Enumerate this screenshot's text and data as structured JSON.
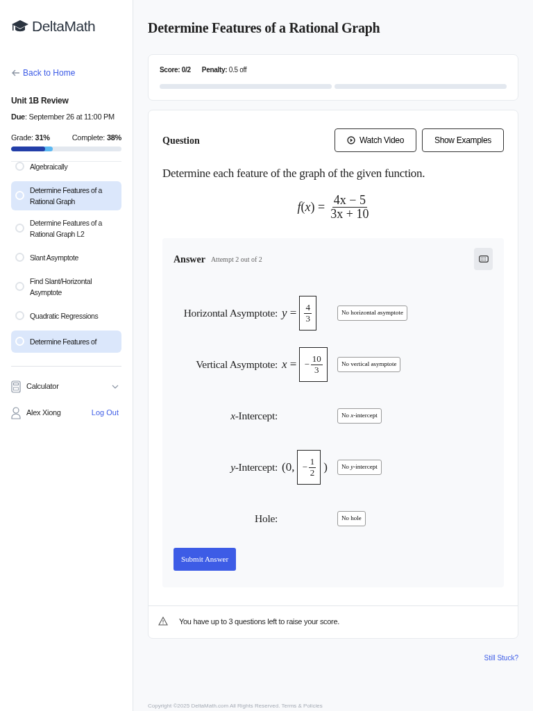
{
  "sidebar": {
    "logo": "DeltaMath",
    "back_link": "Back to Home",
    "assignment": {
      "title": "Unit 1B Review",
      "due": "**Due**: September 26 at 11:00 PM",
      "grade": "Grade: **31%**",
      "complete": "Complete: **38%**"
    },
    "progress": [
      {
        "kind": "grade",
        "level": 0.31
      },
      {
        "kind": "complete",
        "level": 0.38
      }
    ],
    "items": [
      {
        "label": "Algebraically",
        "selected": false
      },
      {
        "label": "Determine Features of a Rational Graph",
        "selected": true
      },
      {
        "label": "Determine Features of a Rational Graph L2",
        "selected": false
      },
      {
        "label": "Slant Asymptote",
        "selected": false
      },
      {
        "label": "Find Slant/Horizontal Asymptote",
        "selected": false
      },
      {
        "label": "Quadratic Regressions",
        "selected": false
      },
      {
        "label": "Determine Features of",
        "selected": true
      }
    ],
    "calculator": "Calculator",
    "user": {
      "name": "Alex Xiong",
      "logout": "Log Out"
    }
  },
  "main": {
    "title": "Determine Features of a Rational Graph",
    "score": {
      "score": "Score: 0/2",
      "penalty": "**Penalty:** 0.5 off",
      "segments": [
        {
          "level": 0
        },
        {
          "level": 0
        }
      ]
    },
    "question": {
      "heading": "Question",
      "buttons": [
        {
          "label": "Watch Video",
          "kind": "video"
        },
        {
          "label": "Show Examples",
          "kind": "plain"
        }
      ],
      "prompt": "Determine each feature of the graph of the given function.",
      "function": {
        "lhs": "*f*(*x*) =",
        "numerator": "4x − 5",
        "denominator": "3x + 10"
      }
    },
    "answer": {
      "heading": "Answer",
      "attempt": "Attempt 2 out of 2",
      "rows": [
        {
          "kind": "equation",
          "label": "Horizontal Asymptote:",
          "lhs": "*y* =",
          "sign": "",
          "numerator": "4",
          "denominator": "3",
          "button": "No horizontal asymptote"
        },
        {
          "kind": "equation",
          "label": "Vertical Asymptote:",
          "lhs": "*x* =",
          "sign": "−",
          "numerator": "10",
          "denominator": "3",
          "button": "No vertical asymptote"
        },
        {
          "kind": "none",
          "label": "*x*-Intercept:",
          "button": "No *x*-intercept"
        },
        {
          "kind": "point",
          "label": "*y*-Intercept:",
          "prefix": "(0,",
          "sign": "−",
          "numerator": "1",
          "denominator": "2",
          "suffix": ")",
          "button": "No *y*-intercept"
        },
        {
          "kind": "none",
          "label": "Hole:",
          "button": "No hole"
        }
      ],
      "submit": "Submit Answer"
    },
    "notice": "You have up to 3 questions left to raise your score.",
    "still_stuck": "Still Stuck?",
    "copyright": "Copyright ©2025 DeltaMath.com All Rights Reserved.",
    "terms": "Terms & Policies"
  }
}
